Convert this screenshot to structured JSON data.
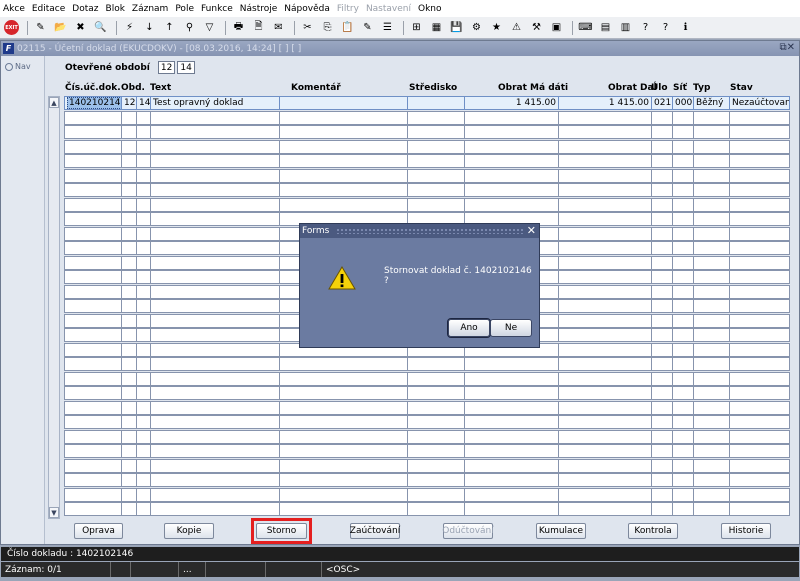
{
  "menu": [
    "Akce",
    "Editace",
    "Dotaz",
    "Blok",
    "Záznam",
    "Pole",
    "Funkce",
    "Nástroje",
    "Nápověda",
    "Filtry",
    "Nastavení",
    "Okno"
  ],
  "menu_disabled": [
    "Filtry",
    "Nastavení"
  ],
  "toolbar": {
    "exit_label": "EXIT",
    "icons": [
      "edit-icon",
      "folder-open-icon",
      "delete-icon",
      "find-icon",
      "execute-query-icon",
      "sort-asc-icon",
      "sort-desc-icon",
      "filter-icon",
      "funnel-icon",
      "print-icon",
      "print-preview-icon",
      "mail-icon",
      "cut-icon",
      "copy-icon",
      "paste-icon",
      "edit-field-icon",
      "list-icon",
      "tree-icon",
      "calendar-icon",
      "save-icon",
      "settings-icon",
      "star-icon",
      "warning-icon",
      "tools-icon",
      "help-window-icon",
      "keyboard-icon",
      "excel-icon",
      "document-icon",
      "help-question-icon",
      "help-icon",
      "info-icon"
    ]
  },
  "window": {
    "title": "02115 - Účetní doklad (EKUCDOKV) - [08.03.2016, 14:24] [ ] [ ]",
    "controls": "⧉✕"
  },
  "nav": {
    "label": "Nav"
  },
  "periods": {
    "label": "Otevřené období",
    "values": [
      "12",
      "14"
    ]
  },
  "columns": [
    "Čís.úč.dok.",
    "Obd.",
    "Text",
    "Komentář",
    "Středisko",
    "Obrat Má dáti",
    "Obrat Dal",
    "Úlo",
    "Síť",
    "Typ",
    "Stav"
  ],
  "rows": [
    {
      "doc_number": "1402102146",
      "period1": "12",
      "period2": "14",
      "text": "Test opravný doklad",
      "comment": "",
      "center": "",
      "debit": "1 415.00",
      "credit": "1 415.00",
      "ulo": "021",
      "sit": "000",
      "type": "Běžný",
      "status": "Nezaúčtovaný"
    }
  ],
  "buttons": {
    "oprava": "Oprava",
    "kopie": "Kopie",
    "storno": "Storno",
    "zauctovani": "Zaúčtování",
    "oductovani": "Odúčtování",
    "kumulace": "Kumulace",
    "kontrola": "Kontrola",
    "historie": "Historie"
  },
  "dialog": {
    "title": "Forms",
    "message": "Stornovat doklad č. 1402102146 ?",
    "yes": "Ano",
    "no": "Ne"
  },
  "status": {
    "line1": "Číslo dokladu : 1402102146",
    "record": "Záznam: 0/1",
    "list_indicator": "...",
    "mode": "<OSC>"
  },
  "colors": {
    "highlight": "#e41f1f",
    "titlebar": "#8694b2",
    "dialog_bg": "#6b7ba1",
    "selected_row": "#e5f0fb"
  }
}
